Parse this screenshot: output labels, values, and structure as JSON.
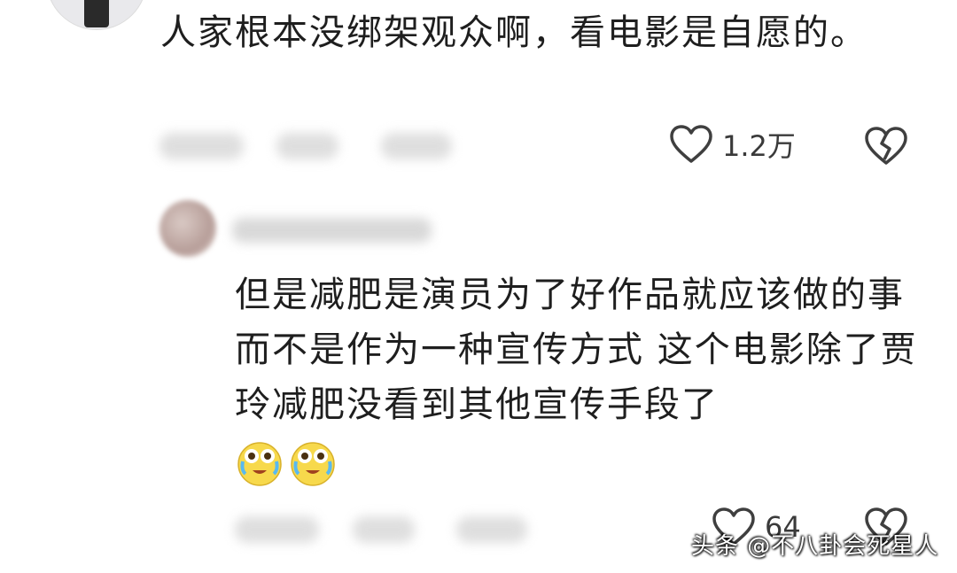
{
  "comment_top": {
    "text": "人家根本没绑架观众啊，看电影是自愿的。",
    "likes": "1.2万"
  },
  "reply": {
    "text": "但是减肥是演员为了好作品就应该做的事 而不是作为一种宣传方式 这个电影除了贾玲减肥没看到其他宣传手段了",
    "emojis": [
      "crying-laugh-emoji",
      "crying-laugh-emoji"
    ],
    "likes": "64"
  },
  "watermark": "头条 @不八卦会死星人",
  "colors": {
    "text": "#1e1e1e",
    "meta": "#3a3a3a",
    "icon": "#3f3f3f",
    "emoji_face": "#f7d94c"
  },
  "icons": [
    "heart-outline-icon",
    "broken-heart-icon"
  ]
}
